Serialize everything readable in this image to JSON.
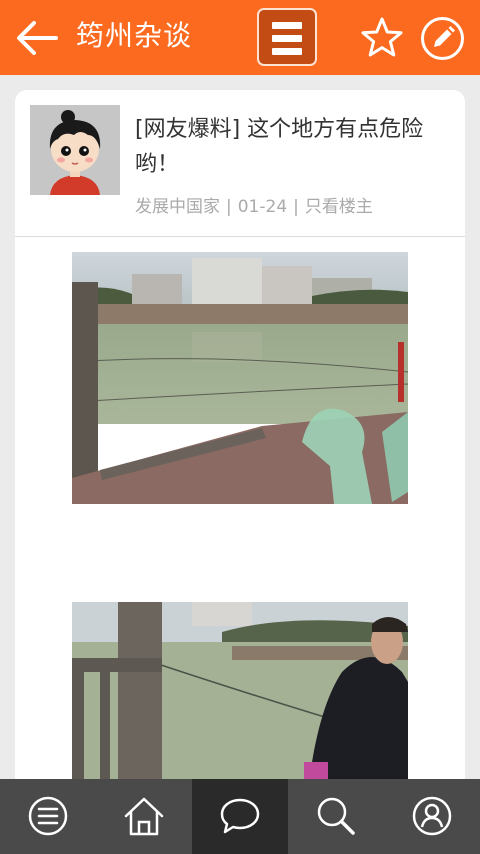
{
  "header": {
    "title": "筠州杂谈"
  },
  "post": {
    "title": "[网友爆料] 这个地方有点危险哟！",
    "author": "发展中国家",
    "date": "01-24",
    "filter_label": "只看楼主"
  },
  "icons": {
    "back": "arrow-left-icon",
    "menu": "menu-icon",
    "favorite": "star-icon",
    "compose": "pencil-icon"
  },
  "bottom_nav": [
    {
      "icon": "list-menu-icon",
      "active": false
    },
    {
      "icon": "home-icon",
      "active": false
    },
    {
      "icon": "chat-bubble-icon",
      "active": true
    },
    {
      "icon": "search-icon",
      "active": false
    },
    {
      "icon": "user-icon",
      "active": false
    }
  ],
  "colors": {
    "header": "#fb6a1f",
    "bottom_bar": "#4a4a4a",
    "bottom_active": "#2a2a2a"
  }
}
